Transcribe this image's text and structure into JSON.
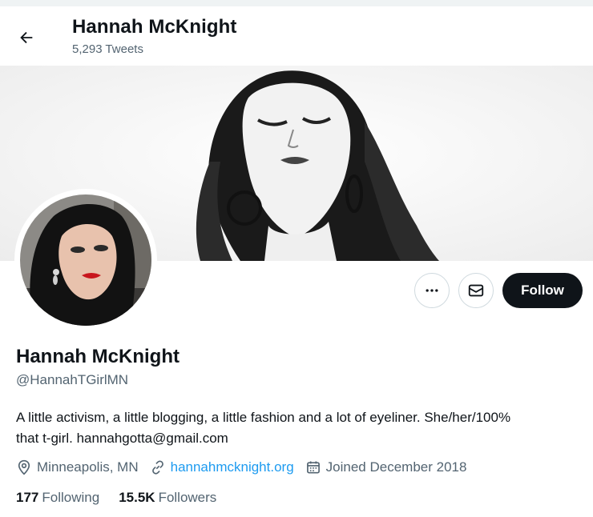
{
  "header": {
    "name": "Hannah McKnight",
    "tweet_count": "5,293 Tweets"
  },
  "actions": {
    "follow_label": "Follow"
  },
  "profile": {
    "name": "Hannah McKnight",
    "handle": "@HannahTGirlMN",
    "bio_line1": "A little activism, a little blogging, a little fashion and a lot of eyeliner. She/her/100%",
    "bio_line2": "that t-girl.  hannahgotta@gmail.com",
    "location": "Minneapolis, MN",
    "website": "hannahmcknight.org",
    "joined": "Joined December 2018"
  },
  "stats": {
    "following_count": "177",
    "following_label": "Following",
    "followers_count": "15.5K",
    "followers_label": "Followers"
  },
  "icons": {
    "back": "arrow-left-icon",
    "more": "more-dots-icon",
    "message": "envelope-icon",
    "location": "location-pin-icon",
    "link": "link-icon",
    "calendar": "calendar-icon"
  },
  "colors": {
    "text": "#0f1419",
    "secondary": "#536471",
    "link": "#1d9bf0",
    "follow_bg": "#0f1419"
  }
}
